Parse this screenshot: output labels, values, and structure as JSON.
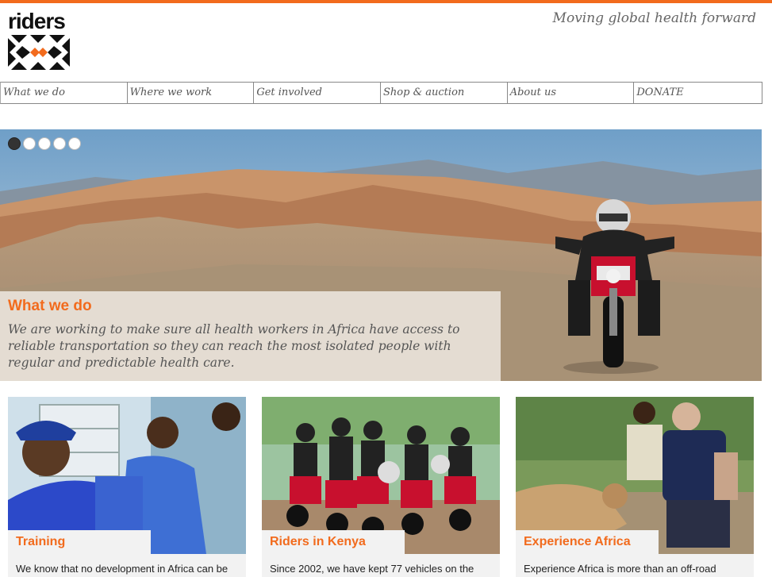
{
  "brand": {
    "name": "riders",
    "tagline": "Moving global health forward",
    "accent": "#f26b1d"
  },
  "nav": [
    {
      "label": "What we do"
    },
    {
      "label": "Where we work"
    },
    {
      "label": "Get involved"
    },
    {
      "label": "Shop & auction"
    },
    {
      "label": "About us"
    },
    {
      "label": "DONATE"
    }
  ],
  "hero": {
    "slides_total": 5,
    "active_slide": 1,
    "title": "What we do",
    "text": "We are working to make sure all health workers in Africa have access to reliable transportation so they can reach the most isolated people with regular and predictable health care."
  },
  "cards": [
    {
      "title": "Training",
      "text": "We know that no development in Africa can be"
    },
    {
      "title": "Riders in Kenya",
      "text": "Since 2002, we have kept 77 vehicles on the"
    },
    {
      "title": "Experience Africa",
      "text": "Experience Africa is more than an off-road"
    }
  ]
}
